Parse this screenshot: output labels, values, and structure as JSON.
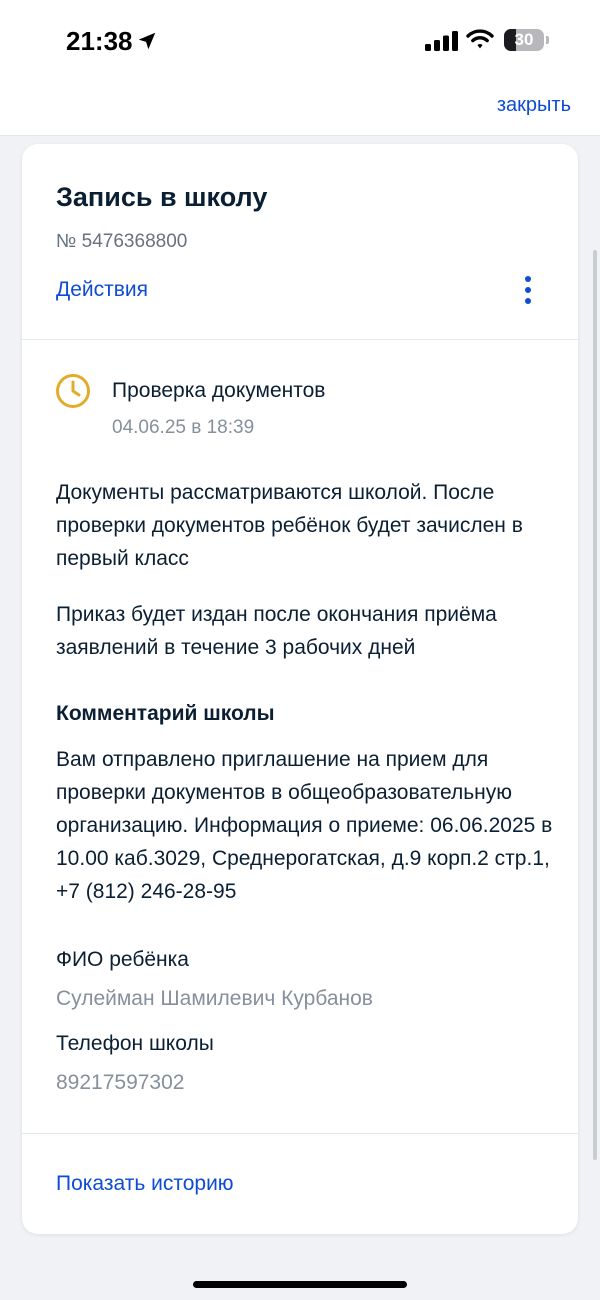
{
  "status_bar": {
    "time": "21:38",
    "battery": "30",
    "battery_level": 0.3,
    "icons": [
      "location-arrow-icon",
      "cellular-signal-icon",
      "wifi-icon",
      "battery-icon"
    ]
  },
  "topbar": {
    "close_label": "закрыть"
  },
  "card": {
    "title": "Запись в школу",
    "number": "№ 5476368800",
    "actions_label": "Действия",
    "more_icon": "more-vertical-icon"
  },
  "status": {
    "icon": "clock-icon",
    "title": "Проверка документов",
    "date": "04.06.25 в 18:39"
  },
  "body": {
    "description": "Документы рассматриваются школой. После проверки документов ребёнок будет зачислен в первый класс",
    "order_note": "Приказ будет издан после окончания приёма заявлений в течение 3 рабочих дней"
  },
  "comment": {
    "title": "Комментарий школы",
    "text": "Вам отправлено приглашение на прием для проверки документов в общеобразовательную организацию. Информация о приеме: 06.06.2025 в 10.00 каб.3029, Среднерогатская, д.9 корп.2 стр.1, +7 (812) 246-28-95"
  },
  "fields": [
    {
      "label": "ФИО ребёнка",
      "value": "Сулейман Шамилевич Курбанов"
    },
    {
      "label": "Телефон школы",
      "value": "89217597302"
    }
  ],
  "footer": {
    "history_label": "Показать историю"
  },
  "colors": {
    "accent": "#0d4cd3",
    "status_icon": "#e3ab2a",
    "text": "#0b1f33",
    "secondary": "#86909c"
  }
}
